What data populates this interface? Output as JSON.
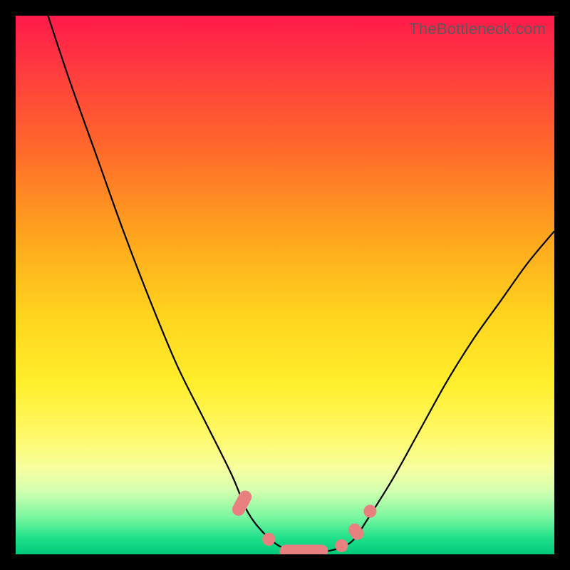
{
  "watermark": "TheBottleneck.com",
  "chart_data": {
    "type": "line",
    "title": "",
    "xlabel": "",
    "ylabel": "",
    "xlim": [
      0,
      100
    ],
    "ylim": [
      0,
      100
    ],
    "series": [
      {
        "name": "bottleneck-curve",
        "x": [
          6,
          10,
          15,
          20,
          25,
          30,
          35,
          40,
          43,
          46,
          49,
          52,
          55,
          58,
          61,
          63,
          65,
          70,
          75,
          80,
          85,
          90,
          95,
          100
        ],
        "values": [
          100,
          88,
          74,
          60,
          47,
          35,
          25,
          15,
          8,
          4,
          1.5,
          0.5,
          0.3,
          0.6,
          1.5,
          3,
          6,
          14,
          23,
          32,
          40,
          47,
          54,
          60
        ]
      }
    ],
    "markers": [
      {
        "shape": "pill",
        "x": 42.0,
        "y": 9.5,
        "len": 5.0,
        "angle": -62
      },
      {
        "shape": "circle",
        "x": 47.0,
        "y": 2.8,
        "r": 1.2
      },
      {
        "shape": "pill",
        "x": 53.5,
        "y": 0.6,
        "len": 9.0,
        "angle": 0
      },
      {
        "shape": "circle",
        "x": 60.5,
        "y": 1.6,
        "r": 1.2
      },
      {
        "shape": "pill",
        "x": 63.2,
        "y": 4.2,
        "len": 3.2,
        "angle": 55
      },
      {
        "shape": "circle",
        "x": 65.8,
        "y": 8.0,
        "r": 1.2
      }
    ],
    "colors": {
      "curve": "#000000",
      "marker": "#e98080",
      "gradient_top": "#ff1a4b",
      "gradient_bottom": "#00c97a"
    }
  }
}
